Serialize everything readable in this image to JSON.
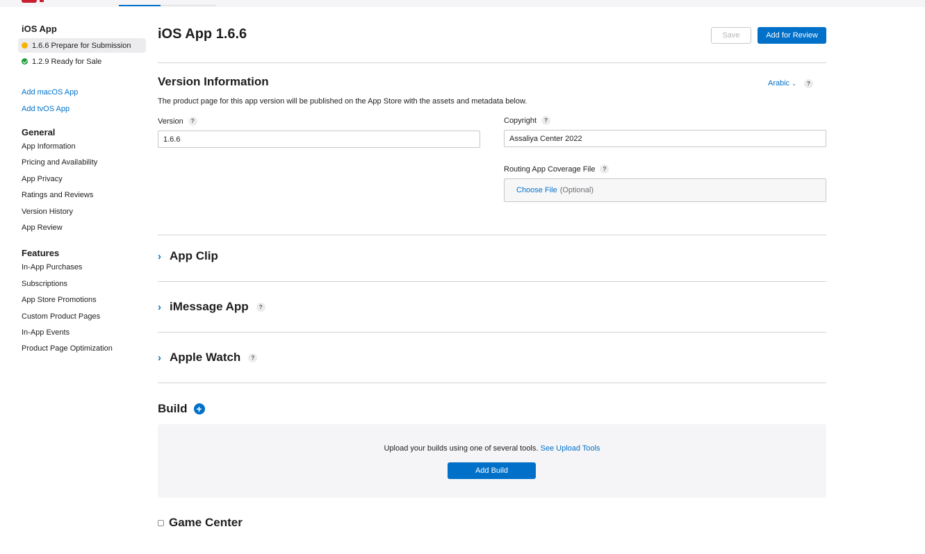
{
  "sidebar": {
    "app_heading": "iOS App",
    "versions": [
      {
        "label": "1.6.6 Prepare for Submission",
        "status_color": "#f5b400"
      },
      {
        "label": "1.2.9 Ready for Sale",
        "status_color": "#1f9a36"
      }
    ],
    "add_links": [
      "Add macOS App",
      "Add tvOS App"
    ],
    "general_heading": "General",
    "general_items": [
      "App Information",
      "Pricing and Availability",
      "App Privacy",
      "Ratings and Reviews",
      "Version History",
      "App Review"
    ],
    "features_heading": "Features",
    "features_items": [
      "In-App Purchases",
      "Subscriptions",
      "App Store Promotions",
      "Custom Product Pages",
      "In-App Events",
      "Product Page Optimization"
    ]
  },
  "header": {
    "title": "iOS App 1.6.6",
    "save_label": "Save",
    "review_label": "Add for Review"
  },
  "version_info": {
    "title": "Version Information",
    "language": "Arabic",
    "description": "The product page for this app version will be published on the App Store with the assets and metadata below.",
    "version_label": "Version",
    "version_value": "1.6.6",
    "copyright_label": "Copyright",
    "copyright_value": "Assaliya Center 2022",
    "routing_label": "Routing App Coverage File",
    "choose_file": "Choose File",
    "optional": "(Optional)"
  },
  "sections": {
    "app_clip": "App Clip",
    "imessage": "iMessage App",
    "apple_watch": "Apple Watch"
  },
  "build": {
    "title": "Build",
    "upload_text": "Upload your builds using one of several tools.",
    "upload_link": "See Upload Tools",
    "add_build_label": "Add Build"
  },
  "game_center": {
    "title": "Game Center"
  },
  "help_glyph": "?",
  "colors": {
    "accent": "#0070c9",
    "pending": "#f5b400",
    "ready": "#1f9a36"
  }
}
